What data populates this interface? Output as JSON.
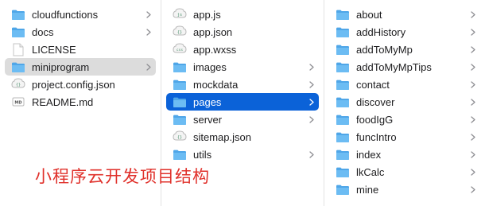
{
  "columns": [
    {
      "items": [
        {
          "label": "cloudfunctions",
          "icon": "folder-icon",
          "chevron": true,
          "state": ""
        },
        {
          "label": "docs",
          "icon": "folder-icon",
          "chevron": true,
          "state": ""
        },
        {
          "label": "LICENSE",
          "icon": "document-icon",
          "chevron": false,
          "state": ""
        },
        {
          "label": "miniprogram",
          "icon": "folder-icon",
          "chevron": true,
          "state": "selected-inactive"
        },
        {
          "label": "project.config.json",
          "icon": "json-file-icon",
          "chevron": false,
          "state": ""
        },
        {
          "label": "README.md",
          "icon": "markdown-file-icon",
          "chevron": false,
          "state": ""
        }
      ]
    },
    {
      "items": [
        {
          "label": "app.js",
          "icon": "js-file-icon",
          "chevron": false,
          "state": ""
        },
        {
          "label": "app.json",
          "icon": "json-file-icon",
          "chevron": false,
          "state": ""
        },
        {
          "label": "app.wxss",
          "icon": "wxss-file-icon",
          "chevron": false,
          "state": ""
        },
        {
          "label": "images",
          "icon": "folder-icon",
          "chevron": true,
          "state": ""
        },
        {
          "label": "mockdata",
          "icon": "folder-icon",
          "chevron": true,
          "state": ""
        },
        {
          "label": "pages",
          "icon": "folder-icon",
          "chevron": true,
          "state": "selected-active"
        },
        {
          "label": "server",
          "icon": "folder-icon",
          "chevron": true,
          "state": ""
        },
        {
          "label": "sitemap.json",
          "icon": "json-file-icon",
          "chevron": false,
          "state": ""
        },
        {
          "label": "utils",
          "icon": "folder-icon",
          "chevron": true,
          "state": ""
        }
      ]
    },
    {
      "items": [
        {
          "label": "about",
          "icon": "folder-icon",
          "chevron": true,
          "state": ""
        },
        {
          "label": "addHistory",
          "icon": "folder-icon",
          "chevron": true,
          "state": ""
        },
        {
          "label": "addToMyMp",
          "icon": "folder-icon",
          "chevron": true,
          "state": ""
        },
        {
          "label": "addToMyMpTips",
          "icon": "folder-icon",
          "chevron": true,
          "state": ""
        },
        {
          "label": "contact",
          "icon": "folder-icon",
          "chevron": true,
          "state": ""
        },
        {
          "label": "discover",
          "icon": "folder-icon",
          "chevron": true,
          "state": ""
        },
        {
          "label": "foodIgG",
          "icon": "folder-icon",
          "chevron": true,
          "state": ""
        },
        {
          "label": "funcIntro",
          "icon": "folder-icon",
          "chevron": true,
          "state": ""
        },
        {
          "label": "index",
          "icon": "folder-icon",
          "chevron": true,
          "state": ""
        },
        {
          "label": "lkCalc",
          "icon": "folder-icon",
          "chevron": true,
          "state": ""
        },
        {
          "label": "mine",
          "icon": "folder-icon",
          "chevron": true,
          "state": ""
        }
      ]
    }
  ],
  "caption": "小程序云开发项目结构",
  "colors": {
    "folder": "#5ab0ee",
    "selection_active": "#0b62d8",
    "selection_inactive": "#dcdcdc",
    "caption": "#e0312b"
  }
}
